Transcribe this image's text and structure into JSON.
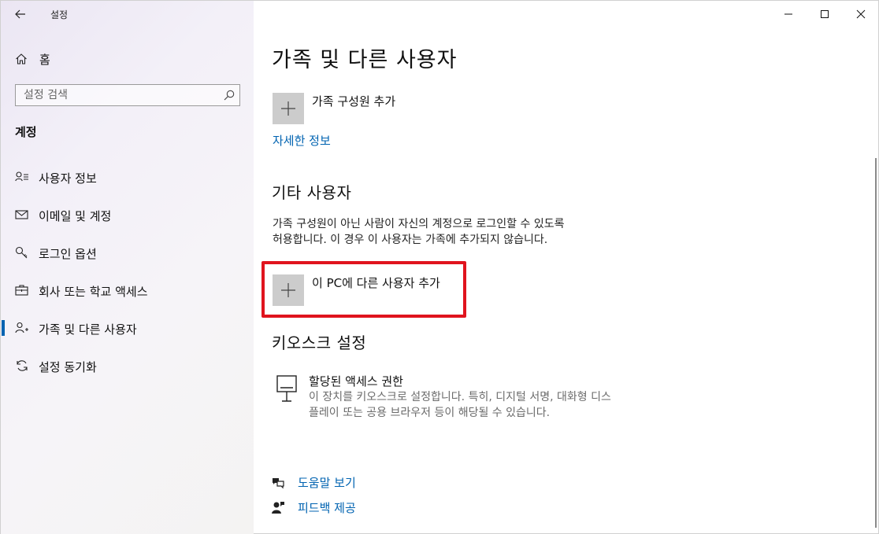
{
  "app": {
    "title": "설정"
  },
  "titlebar": {
    "minimize_label": "—",
    "maximize_label": "☐",
    "close_label": "✕"
  },
  "sidebar": {
    "home_label": "홈",
    "search_placeholder": "설정 검색",
    "section_title": "계정",
    "items": [
      {
        "label": "사용자 정보",
        "icon": "user-info-icon"
      },
      {
        "label": "이메일 및 계정",
        "icon": "mail-icon"
      },
      {
        "label": "로그인 옵션",
        "icon": "key-icon"
      },
      {
        "label": "회사 또는 학교 액세스",
        "icon": "briefcase-icon"
      },
      {
        "label": "가족 및 다른 사용자",
        "icon": "people-icon",
        "active": true
      },
      {
        "label": "설정 동기화",
        "icon": "sync-icon"
      }
    ],
    "accent_color": "#0063b1"
  },
  "main": {
    "title": "가족 및 다른 사용자",
    "family": {
      "add_label": "가족 구성원 추가",
      "more_info_link": "자세한 정보"
    },
    "other_users": {
      "heading": "기타 사용자",
      "description_line1": "가족 구성원이 아닌 사람이 자신의 계정으로 로그인할 수 있도록",
      "description_line2": "허용합니다. 이 경우 이 사용자는 가족에 추가되지 않습니다.",
      "add_label": "이 PC에 다른 사용자 추가"
    },
    "kiosk": {
      "heading": "키오스크 설정",
      "title": "할당된 액세스 권한",
      "description": "이 장치를 키오스크로 설정합니다. 특히, 디지털 서명, 대화형 디스플레이 또는 공용 브라우저 등이 해당될 수 있습니다."
    },
    "help": {
      "help_link": "도움말 보기",
      "feedback_link": "피드백 제공"
    },
    "highlight_color": "#e0141e"
  }
}
